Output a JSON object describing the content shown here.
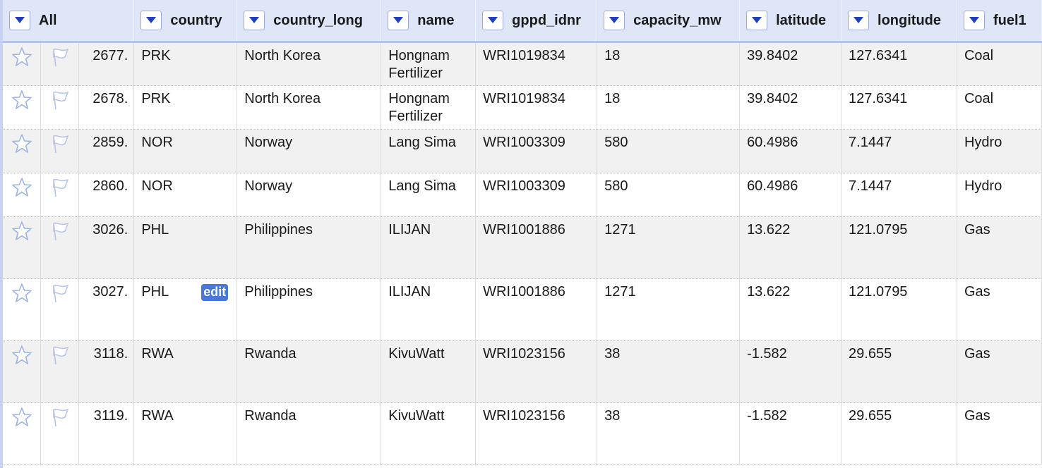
{
  "header": {
    "all_label": "All",
    "columns": [
      "country",
      "country_long",
      "name",
      "gppd_idnr",
      "capacity_mw",
      "latitude",
      "longitude",
      "fuel1"
    ]
  },
  "rows": [
    {
      "index": "2677.",
      "country": "PRK",
      "country_long": "North Korea",
      "name": "Hongnam Fertilizer",
      "gppd_idnr": "WRI1019834",
      "capacity_mw": "18",
      "latitude": "39.8402",
      "longitude": "127.6341",
      "fuel1": "Coal"
    },
    {
      "index": "2678.",
      "country": "PRK",
      "country_long": "North Korea",
      "name": "Hongnam Fertilizer",
      "gppd_idnr": "WRI1019834",
      "capacity_mw": "18",
      "latitude": "39.8402",
      "longitude": "127.6341",
      "fuel1": "Coal"
    },
    {
      "index": "2859.",
      "country": "NOR",
      "country_long": "Norway",
      "name": "Lang Sima",
      "gppd_idnr": "WRI1003309",
      "capacity_mw": "580",
      "latitude": "60.4986",
      "longitude": "7.1447",
      "fuel1": "Hydro"
    },
    {
      "index": "2860.",
      "country": "NOR",
      "country_long": "Norway",
      "name": "Lang Sima",
      "gppd_idnr": "WRI1003309",
      "capacity_mw": "580",
      "latitude": "60.4986",
      "longitude": "7.1447",
      "fuel1": "Hydro"
    },
    {
      "index": "3026.",
      "country": "PHL",
      "country_long": "Philippines",
      "name": "ILIJAN",
      "gppd_idnr": "WRI1001886",
      "capacity_mw": "1271",
      "latitude": "13.622",
      "longitude": "121.0795",
      "fuel1": "Gas"
    },
    {
      "index": "3027.",
      "country": "PHL",
      "country_long": "Philippines",
      "name": "ILIJAN",
      "gppd_idnr": "WRI1001886",
      "capacity_mw": "1271",
      "latitude": "13.622",
      "longitude": "121.0795",
      "fuel1": "Gas",
      "edit_label": "edit"
    },
    {
      "index": "3118.",
      "country": "RWA",
      "country_long": "Rwanda",
      "name": "KivuWatt",
      "gppd_idnr": "WRI1023156",
      "capacity_mw": "38",
      "latitude": "-1.582",
      "longitude": "29.655",
      "fuel1": "Gas"
    },
    {
      "index": "3119.",
      "country": "RWA",
      "country_long": "Rwanda",
      "name": "KivuWatt",
      "gppd_idnr": "WRI1023156",
      "capacity_mw": "38",
      "latitude": "-1.582",
      "longitude": "29.655",
      "fuel1": "Gas"
    }
  ],
  "icons": {
    "star": "star-icon",
    "flag": "flag-icon",
    "dropdown": "dropdown-triangle-icon"
  },
  "colors": {
    "header_bg": "#dfe6f7",
    "dropdown_arrow": "#1f3fbf",
    "star_outline": "#9db4e6",
    "edit_badge": "#4a78d6"
  }
}
